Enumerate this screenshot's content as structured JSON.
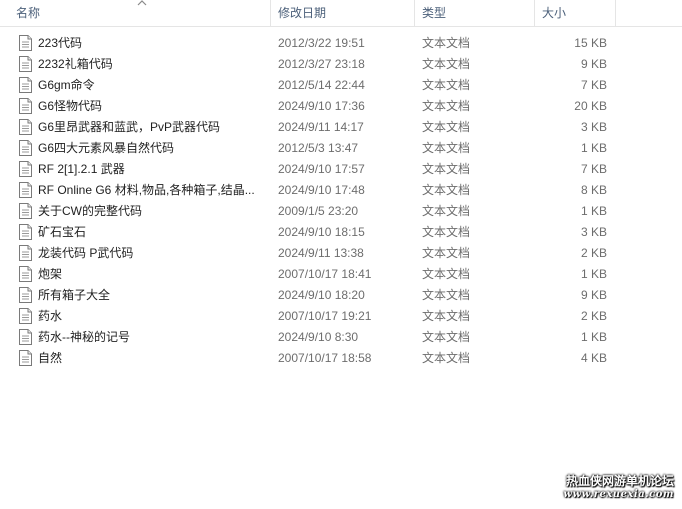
{
  "columns": {
    "name": "名称",
    "date": "修改日期",
    "type": "类型",
    "size": "大小"
  },
  "files": [
    {
      "name": "223代码",
      "date": "2012/3/22 19:51",
      "type": "文本文档",
      "size": "15 KB"
    },
    {
      "name": "2232礼箱代码",
      "date": "2012/3/27 23:18",
      "type": "文本文档",
      "size": "9 KB"
    },
    {
      "name": "G6gm命令",
      "date": "2012/5/14 22:44",
      "type": "文本文档",
      "size": "7 KB"
    },
    {
      "name": "G6怪物代码",
      "date": "2024/9/10 17:36",
      "type": "文本文档",
      "size": "20 KB"
    },
    {
      "name": "G6里昂武器和蓝武，PvP武器代码",
      "date": "2024/9/11 14:17",
      "type": "文本文档",
      "size": "3 KB"
    },
    {
      "name": "G6四大元素风暴自然代码",
      "date": "2012/5/3 13:47",
      "type": "文本文档",
      "size": "1 KB"
    },
    {
      "name": "RF 2[1].2.1 武器",
      "date": "2024/9/10 17:57",
      "type": "文本文档",
      "size": "7 KB"
    },
    {
      "name": "RF Online G6 材料,物品,各种箱子,结晶...",
      "date": "2024/9/10 17:48",
      "type": "文本文档",
      "size": "8 KB"
    },
    {
      "name": "关于CW的完整代码",
      "date": "2009/1/5 23:20",
      "type": "文本文档",
      "size": "1 KB"
    },
    {
      "name": "矿石宝石",
      "date": "2024/9/10 18:15",
      "type": "文本文档",
      "size": "3 KB"
    },
    {
      "name": "龙装代码 P武代码",
      "date": "2024/9/11 13:38",
      "type": "文本文档",
      "size": "2 KB"
    },
    {
      "name": "炮架",
      "date": "2007/10/17 18:41",
      "type": "文本文档",
      "size": "1 KB"
    },
    {
      "name": "所有箱子大全",
      "date": "2024/9/10 18:20",
      "type": "文本文档",
      "size": "9 KB"
    },
    {
      "name": "药水",
      "date": "2007/10/17 19:21",
      "type": "文本文档",
      "size": "2 KB"
    },
    {
      "name": "药水--神秘的记号",
      "date": "2024/9/10 8:30",
      "type": "文本文档",
      "size": "1 KB"
    },
    {
      "name": "自然",
      "date": "2007/10/17 18:58",
      "type": "文本文档",
      "size": "4 KB"
    }
  ],
  "icons": {
    "file": "text-document-icon",
    "sort": "sort-ascending-icon"
  },
  "watermark": {
    "title": "热血侠网游单机论坛",
    "url": "www.rexuexia.com"
  }
}
